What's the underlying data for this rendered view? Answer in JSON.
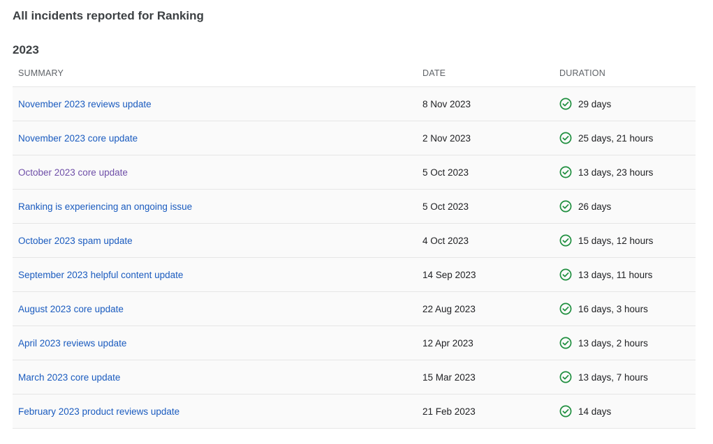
{
  "page_title": "All incidents reported for Ranking",
  "year": "2023",
  "columns": {
    "summary": "Summary",
    "date": "Date",
    "duration": "Duration"
  },
  "status_color": "#1e8e3e",
  "link_color": "#1a5bbf",
  "visited_link_color": "#6f4fa8",
  "status_icon": "check-circle-icon",
  "incidents": [
    {
      "summary": "November 2023 reviews update",
      "date": "8 Nov 2023",
      "duration": "29 days",
      "visited": false
    },
    {
      "summary": "November 2023 core update",
      "date": "2 Nov 2023",
      "duration": "25 days, 21 hours",
      "visited": false
    },
    {
      "summary": "October 2023 core update",
      "date": "5 Oct 2023",
      "duration": "13 days, 23 hours",
      "visited": true
    },
    {
      "summary": "Ranking is experiencing an ongoing issue",
      "date": "5 Oct 2023",
      "duration": "26 days",
      "visited": false
    },
    {
      "summary": "October 2023 spam update",
      "date": "4 Oct 2023",
      "duration": "15 days, 12 hours",
      "visited": false
    },
    {
      "summary": "September 2023 helpful content update",
      "date": "14 Sep 2023",
      "duration": "13 days, 11 hours",
      "visited": false
    },
    {
      "summary": "August 2023 core update",
      "date": "22 Aug 2023",
      "duration": "16 days, 3 hours",
      "visited": false
    },
    {
      "summary": "April 2023 reviews update",
      "date": "12 Apr 2023",
      "duration": "13 days, 2 hours",
      "visited": false
    },
    {
      "summary": "March 2023 core update",
      "date": "15 Mar 2023",
      "duration": "13 days, 7 hours",
      "visited": false
    },
    {
      "summary": "February 2023 product reviews update",
      "date": "21 Feb 2023",
      "duration": "14 days",
      "visited": false
    }
  ]
}
